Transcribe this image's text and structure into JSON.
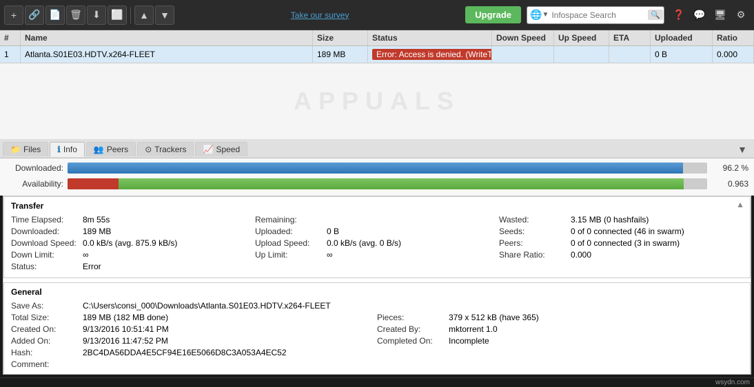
{
  "toolbar": {
    "survey_link": "Take our survey",
    "upgrade_label": "Upgrade",
    "search_placeholder": "Infospace Search",
    "buttons": [
      "+",
      "🔗",
      "📄",
      "🗑",
      "⬇",
      "⬜",
      "▲",
      "▼"
    ]
  },
  "table": {
    "headers": [
      "#",
      "Name",
      "Size",
      "Status",
      "Down Speed",
      "Up Speed",
      "ETA",
      "Uploaded",
      "Ratio"
    ],
    "rows": [
      {
        "num": "1",
        "name": "Atlanta.S01E03.HDTV.x264-FLEET",
        "size": "189 MB",
        "status": "Error: Access is denied. (WriteToDisk)",
        "down_speed": "",
        "up_speed": "",
        "eta": "",
        "uploaded": "0 B",
        "ratio": "0.000"
      }
    ]
  },
  "tabs": [
    {
      "id": "files",
      "label": "Files",
      "icon": "📁"
    },
    {
      "id": "info",
      "label": "Info",
      "icon": "ℹ",
      "active": true
    },
    {
      "id": "peers",
      "label": "Peers",
      "icon": "👥"
    },
    {
      "id": "trackers",
      "label": "Trackers",
      "icon": "⊙"
    },
    {
      "id": "speed",
      "label": "Speed",
      "icon": "📈"
    }
  ],
  "progress": {
    "downloaded_label": "Downloaded:",
    "downloaded_value": "96.2 %",
    "downloaded_pct": 96.2,
    "availability_label": "Availability:",
    "availability_value": "0.963",
    "availability_pct": 96.3
  },
  "transfer": {
    "section_title": "Transfer",
    "fields": [
      {
        "key": "Time Elapsed:",
        "val": "8m 55s"
      },
      {
        "key": "Downloaded:",
        "val": "189 MB"
      },
      {
        "key": "Download Speed:",
        "val": "0.0 kB/s (avg. 875.9 kB/s)"
      },
      {
        "key": "Down Limit:",
        "val": "∞"
      },
      {
        "key": "Status:",
        "val": "Error"
      }
    ],
    "fields_mid": [
      {
        "key": "Remaining:",
        "val": ""
      },
      {
        "key": "Uploaded:",
        "val": "0 B"
      },
      {
        "key": "Upload Speed:",
        "val": "0.0 kB/s (avg. 0 B/s)"
      },
      {
        "key": "Up Limit:",
        "val": "∞"
      }
    ],
    "fields_right": [
      {
        "key": "Wasted:",
        "val": "3.15 MB (0 hashfails)"
      },
      {
        "key": "Seeds:",
        "val": "0 of 0 connected (46 in swarm)"
      },
      {
        "key": "Peers:",
        "val": "0 of 0 connected (3 in swarm)"
      },
      {
        "key": "Share Ratio:",
        "val": "0.000"
      }
    ]
  },
  "general": {
    "section_title": "General",
    "save_as_key": "Save As:",
    "save_as_val": "C:\\Users\\consi_000\\Downloads\\Atlanta.S01E03.HDTV.x264-FLEET",
    "total_size_key": "Total Size:",
    "total_size_val": "189 MB (182 MB done)",
    "created_on_key": "Created On:",
    "created_on_val": "9/13/2016 10:51:41 PM",
    "added_on_key": "Added On:",
    "added_on_val": "9/13/2016 11:47:52 PM",
    "hash_key": "Hash:",
    "hash_val": "2BC4DA56DDA4E5CF94E16E5066D8C3A053A4EC52",
    "comment_key": "Comment:",
    "comment_val": "",
    "pieces_key": "Pieces:",
    "pieces_val": "379 x 512 kB (have 365)",
    "created_by_key": "Created By:",
    "created_by_val": "mktorrent 1.0",
    "completed_on_key": "Completed On:",
    "completed_on_val": "Incomplete"
  },
  "watermark": "APPUALS",
  "footer": "wsydn.com"
}
